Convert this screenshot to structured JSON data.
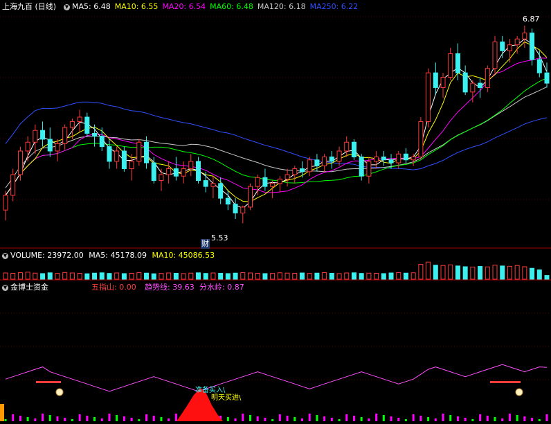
{
  "main": {
    "title": "上海九百 (日线)",
    "ma": [
      {
        "label": "MA5: 6.48",
        "color": "#ffffff"
      },
      {
        "label": "MA10: 6.55",
        "color": "#ffff00"
      },
      {
        "label": "MA20: 6.54",
        "color": "#ff00ff"
      },
      {
        "label": "MA60: 6.48",
        "color": "#00ff00"
      },
      {
        "label": "MA120: 6.18",
        "color": "#c8c8c8"
      },
      {
        "label": "MA250: 6.22",
        "color": "#3050ff"
      }
    ],
    "high_label": "6.87",
    "low_label": "5.53",
    "low_marker": "财"
  },
  "volume": {
    "label": "VOLUME: 23972.00",
    "ma5": "MA5: 45178.09",
    "ma10": "MA10: 45086.53"
  },
  "indicator": {
    "title": "金博士资金",
    "v1": "五指山: 0.00",
    "v2": "趋势线: 39.63",
    "v3": "分水岭: 0.87",
    "sig1": "准备买入\\",
    "sig2": "明天买进\\",
    "bag": "$"
  },
  "colors": {
    "up": "#ff3c3c",
    "down": "#3cf0f0",
    "bg": "#000000"
  },
  "chart_data": {
    "type": "candlestick",
    "price_range": [
      5.4,
      6.95
    ],
    "candles": [
      [
        5.62,
        5.75,
        5.55,
        5.72
      ],
      [
        5.72,
        5.9,
        5.68,
        5.86
      ],
      [
        5.86,
        6.05,
        5.82,
        6.02
      ],
      [
        6.02,
        6.12,
        5.95,
        6.08
      ],
      [
        6.08,
        6.2,
        6.0,
        6.16
      ],
      [
        6.16,
        6.22,
        6.05,
        6.1
      ],
      [
        6.1,
        6.18,
        5.98,
        6.02
      ],
      [
        6.02,
        6.1,
        5.95,
        6.07
      ],
      [
        6.07,
        6.2,
        6.03,
        6.18
      ],
      [
        6.18,
        6.24,
        6.1,
        6.22
      ],
      [
        6.22,
        6.3,
        6.15,
        6.25
      ],
      [
        6.25,
        6.28,
        6.12,
        6.14
      ],
      [
        6.14,
        6.2,
        6.05,
        6.12
      ],
      [
        6.12,
        6.18,
        6.02,
        6.05
      ],
      [
        6.05,
        6.1,
        5.9,
        5.95
      ],
      [
        5.95,
        6.05,
        5.9,
        6.02
      ],
      [
        6.02,
        6.05,
        5.88,
        5.9
      ],
      [
        5.9,
        6.0,
        5.82,
        5.95
      ],
      [
        5.95,
        6.1,
        5.92,
        6.08
      ],
      [
        6.08,
        6.12,
        5.9,
        5.94
      ],
      [
        5.94,
        5.98,
        5.8,
        5.82
      ],
      [
        5.82,
        5.9,
        5.75,
        5.86
      ],
      [
        5.86,
        5.95,
        5.8,
        5.9
      ],
      [
        5.9,
        5.98,
        5.82,
        5.85
      ],
      [
        5.85,
        5.95,
        5.8,
        5.9
      ],
      [
        5.9,
        6.0,
        5.85,
        5.95
      ],
      [
        5.95,
        5.98,
        5.8,
        5.82
      ],
      [
        5.82,
        5.88,
        5.74,
        5.78
      ],
      [
        5.78,
        5.85,
        5.7,
        5.8
      ],
      [
        5.8,
        5.84,
        5.66,
        5.7
      ],
      [
        5.7,
        5.75,
        5.62,
        5.66
      ],
      [
        5.66,
        5.7,
        5.56,
        5.6
      ],
      [
        5.6,
        5.65,
        5.53,
        5.64
      ],
      [
        5.64,
        5.8,
        5.62,
        5.78
      ],
      [
        5.78,
        5.86,
        5.72,
        5.84
      ],
      [
        5.84,
        5.9,
        5.75,
        5.78
      ],
      [
        5.78,
        5.82,
        5.7,
        5.8
      ],
      [
        5.8,
        5.85,
        5.74,
        5.83
      ],
      [
        5.83,
        5.9,
        5.78,
        5.86
      ],
      [
        5.86,
        5.92,
        5.8,
        5.9
      ],
      [
        5.9,
        5.95,
        5.84,
        5.88
      ],
      [
        5.88,
        5.98,
        5.85,
        5.96
      ],
      [
        5.96,
        6.0,
        5.88,
        5.92
      ],
      [
        5.92,
        6.0,
        5.88,
        5.98
      ],
      [
        5.98,
        6.02,
        5.9,
        5.95
      ],
      [
        5.95,
        6.05,
        5.92,
        6.02
      ],
      [
        6.02,
        6.12,
        5.98,
        6.08
      ],
      [
        6.08,
        6.1,
        5.96,
        5.98
      ],
      [
        5.98,
        6.0,
        5.82,
        5.85
      ],
      [
        5.85,
        5.98,
        5.8,
        5.95
      ],
      [
        5.95,
        6.02,
        5.9,
        5.98
      ],
      [
        5.98,
        6.02,
        5.92,
        5.96
      ],
      [
        5.96,
        6.0,
        5.9,
        5.94
      ],
      [
        5.94,
        6.02,
        5.9,
        6.0
      ],
      [
        6.0,
        6.04,
        5.94,
        5.96
      ],
      [
        5.96,
        6.0,
        5.92,
        5.98
      ],
      [
        5.98,
        6.25,
        5.96,
        6.22
      ],
      [
        6.22,
        6.58,
        6.18,
        6.55
      ],
      [
        6.55,
        6.62,
        6.4,
        6.45
      ],
      [
        6.45,
        6.55,
        6.38,
        6.52
      ],
      [
        6.52,
        6.72,
        6.5,
        6.68
      ],
      [
        6.68,
        6.75,
        6.5,
        6.55
      ],
      [
        6.55,
        6.6,
        6.4,
        6.42
      ],
      [
        6.42,
        6.5,
        6.35,
        6.48
      ],
      [
        6.48,
        6.52,
        6.38,
        6.45
      ],
      [
        6.45,
        6.6,
        6.42,
        6.58
      ],
      [
        6.58,
        6.8,
        6.55,
        6.76
      ],
      [
        6.76,
        6.8,
        6.65,
        6.7
      ],
      [
        6.7,
        6.78,
        6.62,
        6.74
      ],
      [
        6.74,
        6.8,
        6.68,
        6.78
      ],
      [
        6.78,
        6.87,
        6.72,
        6.82
      ],
      [
        6.82,
        6.85,
        6.6,
        6.64
      ],
      [
        6.64,
        6.7,
        6.52,
        6.55
      ],
      [
        6.55,
        6.62,
        6.45,
        6.48
      ]
    ],
    "volume_range": [
      0,
      120000
    ],
    "volumes": [
      40000,
      38000,
      42000,
      45000,
      39000,
      36000,
      41000,
      37000,
      43000,
      40000,
      38000,
      35000,
      39000,
      41000,
      37000,
      40000,
      36000,
      38000,
      42000,
      39000,
      35000,
      37000,
      40000,
      38000,
      36000,
      39000,
      41000,
      37000,
      40000,
      38000,
      36000,
      39000,
      42000,
      40000,
      38000,
      36000,
      37000,
      41000,
      39000,
      38000,
      40000,
      37000,
      39000,
      42000,
      38000,
      36000,
      40000,
      41000,
      37000,
      39000,
      38000,
      36000,
      40000,
      42000,
      39000,
      41000,
      95000,
      110000,
      90000,
      88000,
      92000,
      85000,
      80000,
      78000,
      82000,
      79000,
      90000,
      85000,
      83000,
      88000,
      80000,
      70000,
      60000,
      23972
    ],
    "indicator_range": [
      0,
      100
    ],
    "trend": [
      30,
      32,
      34,
      36,
      38,
      40,
      36,
      34,
      32,
      30,
      28,
      26,
      24,
      22,
      20,
      22,
      24,
      26,
      28,
      30,
      32,
      30,
      28,
      26,
      24,
      22,
      20,
      22,
      24,
      26,
      28,
      30,
      32,
      34,
      36,
      34,
      32,
      30,
      28,
      26,
      24,
      22,
      24,
      26,
      28,
      30,
      32,
      34,
      36,
      34,
      32,
      30,
      28,
      26,
      28,
      30,
      34,
      38,
      40,
      38,
      36,
      34,
      32,
      34,
      36,
      38,
      40,
      42,
      40,
      38,
      36,
      38,
      40,
      39.63
    ],
    "bars": [
      0,
      0,
      0,
      0,
      0,
      0,
      0,
      0,
      0,
      0,
      0,
      0,
      0,
      0,
      0,
      0,
      0,
      0,
      0,
      0,
      0,
      0,
      0,
      0,
      0,
      0,
      0,
      0,
      0,
      0,
      0,
      0,
      0,
      0,
      0,
      0,
      0,
      0,
      0,
      0,
      0,
      0,
      0,
      0,
      0,
      0,
      0,
      0,
      0,
      0,
      0,
      0,
      0,
      0,
      0,
      0,
      0,
      0,
      0,
      0,
      0,
      0,
      0,
      0,
      0,
      0,
      0,
      0,
      0,
      0,
      0,
      0,
      0,
      0
    ]
  }
}
